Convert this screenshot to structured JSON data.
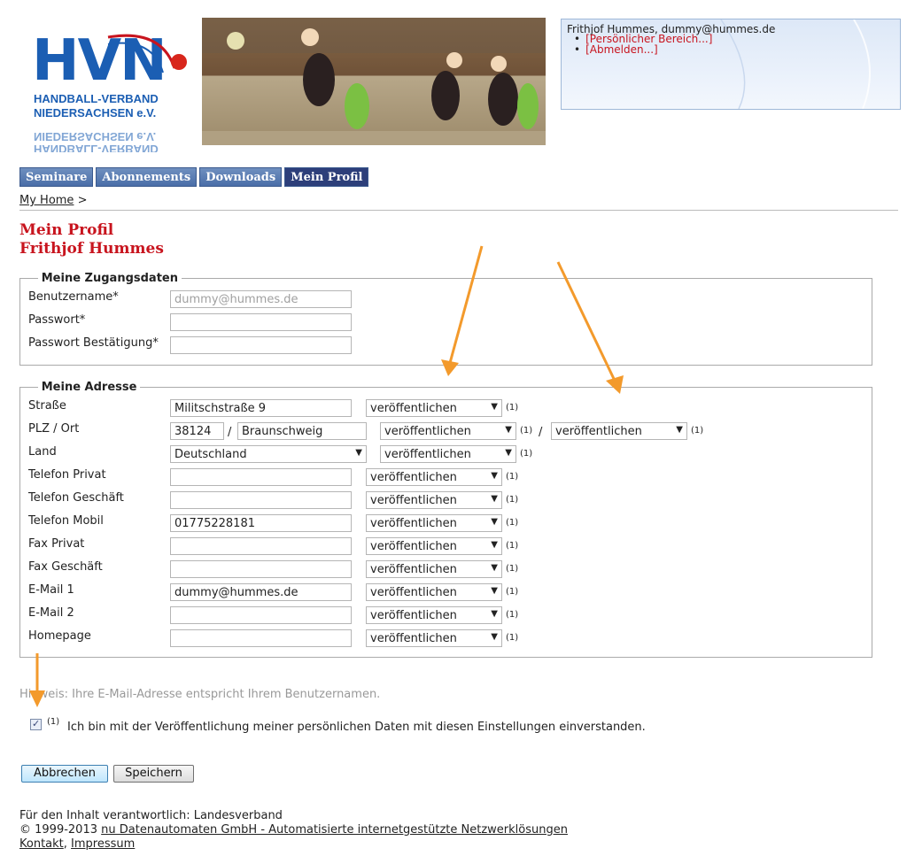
{
  "logo": {
    "letters": "HVN",
    "line1": "HANDBALL-VERBAND",
    "line2": "NIEDERSACHSEN e.V.",
    "mirror1": "NIEDERSACHSEN e.V.",
    "mirror2": "HANDBALL-VERBAND"
  },
  "user": {
    "header": "Frithjof Hummes, dummy@hummes.de",
    "links": [
      "[Persönlicher Bereich...]",
      "[Abmelden...]"
    ]
  },
  "tabs": [
    "Seminare",
    "Abonnements",
    "Downloads",
    "Mein Profil"
  ],
  "breadcrumb": {
    "home": "My Home",
    "sep": ">"
  },
  "page": {
    "title": "Mein Profil",
    "subtitle": "Frithjof Hummes"
  },
  "access": {
    "legend": "Meine Zugangsdaten",
    "username_label": "Benutzername*",
    "username_value": "dummy@hummes.de",
    "password_label": "Passwort*",
    "password_confirm_label": "Passwort Bestätigung*"
  },
  "address": {
    "legend": "Meine Adresse",
    "publish": "veröffentlichen",
    "note": "(1)",
    "slash": "/",
    "street": {
      "label": "Straße",
      "value": "Militschstraße 9"
    },
    "city": {
      "label": "PLZ / Ort",
      "zip": "38124",
      "city": "Braunschweig"
    },
    "country": {
      "label": "Land",
      "value": "Deutschland"
    },
    "phone_private": {
      "label": "Telefon Privat",
      "value": ""
    },
    "phone_business": {
      "label": "Telefon Geschäft",
      "value": ""
    },
    "phone_mobile": {
      "label": "Telefon Mobil",
      "value": "01775228181"
    },
    "fax_private": {
      "label": "Fax Privat",
      "value": ""
    },
    "fax_business": {
      "label": "Fax Geschäft",
      "value": ""
    },
    "email1": {
      "label": "E-Mail 1",
      "value": "dummy@hummes.de"
    },
    "email2": {
      "label": "E-Mail 2",
      "value": ""
    },
    "homepage": {
      "label": "Homepage",
      "value": ""
    }
  },
  "hint": "Hinweis: Ihre E-Mail-Adresse entspricht Ihrem Benutzernamen.",
  "consent": {
    "sup": "(1)",
    "text": "Ich bin mit der Veröffentlichung meiner persönlichen Daten mit diesen Einstellungen einverstanden.",
    "checked": true
  },
  "buttons": {
    "cancel": "Abbrechen",
    "save": "Speichern"
  },
  "footer": {
    "line1": "Für den Inhalt verantwortlich: Landesverband",
    "copyright": "© 1999-2013",
    "company": "nu Datenautomaten GmbH - Automatisierte internetgestützte Netzwerklösungen",
    "contact": "Kontakt",
    "sep": ",",
    "imprint": "Impressum"
  },
  "colors": {
    "accent_red": "#c8141e",
    "tab_blue": "#4a6ea8",
    "tab_active": "#2d3f7a",
    "annotation_arrow": "#f39a2c"
  }
}
